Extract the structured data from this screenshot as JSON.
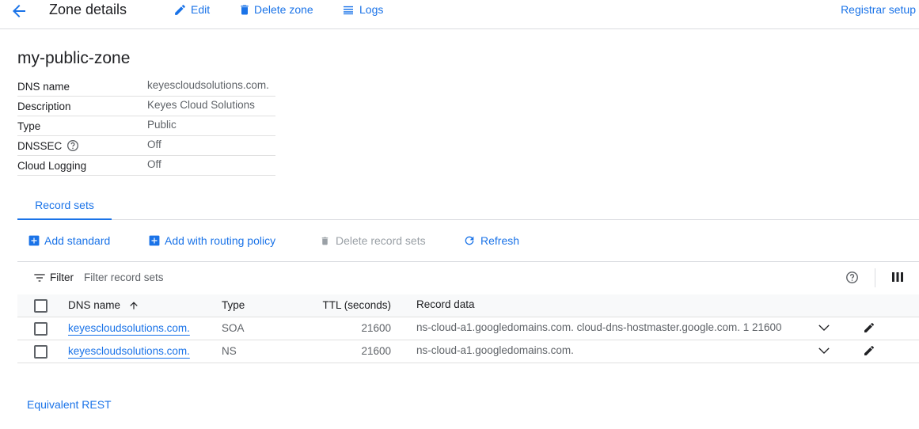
{
  "header": {
    "title": "Zone details",
    "edit_label": "Edit",
    "delete_zone_label": "Delete zone",
    "logs_label": "Logs",
    "registrar_label": "Registrar setup"
  },
  "zone": {
    "name": "my-public-zone",
    "details": [
      {
        "key": "DNS name",
        "value": "keyescloudsolutions.com."
      },
      {
        "key": "Description",
        "value": "Keyes Cloud Solutions"
      },
      {
        "key": "Type",
        "value": "Public"
      },
      {
        "key": "DNSSEC",
        "value": "Off"
      },
      {
        "key": "Cloud Logging",
        "value": "Off"
      }
    ]
  },
  "tabs": [
    {
      "label": "Record sets",
      "active": true
    }
  ],
  "actions": {
    "add_standard": "Add standard",
    "add_routing": "Add with routing policy",
    "delete_records": "Delete record sets",
    "refresh": "Refresh"
  },
  "filter": {
    "label": "Filter",
    "placeholder": "Filter record sets"
  },
  "table": {
    "columns": [
      "DNS name",
      "Type",
      "TTL (seconds)",
      "Record data"
    ],
    "sort": "ascending",
    "rows": [
      {
        "dns_name": "keyescloudsolutions.com.",
        "type": "SOA",
        "ttl": "21600",
        "data": "ns-cloud-a1.googledomains.com. cloud-dns-hostmaster.google.com. 1 21600"
      },
      {
        "dns_name": "keyescloudsolutions.com.",
        "type": "NS",
        "ttl": "21600",
        "data": "ns-cloud-a1.googledomains.com."
      }
    ]
  },
  "footer": {
    "equivalent_rest": "Equivalent REST"
  },
  "icons": {
    "back": "arrow-back-icon",
    "edit": "pencil-icon",
    "delete": "trash-icon",
    "logs": "list-icon",
    "help": "help-circle-icon",
    "add": "add-box-icon",
    "refresh": "refresh-icon",
    "filter": "filter-list-icon",
    "columns": "column-view-icon",
    "sort": "arrow-up-icon",
    "expand": "chevron-down-icon"
  },
  "colors": {
    "accent": "#1a73e8",
    "disabled": "#9aa0a6",
    "text": "#202124",
    "muted": "#5f6368"
  }
}
